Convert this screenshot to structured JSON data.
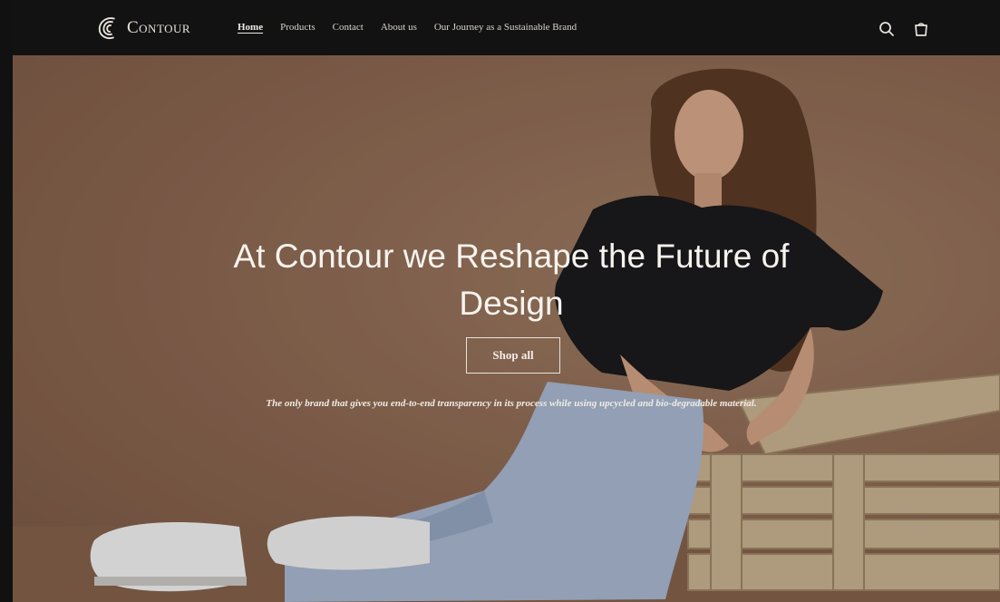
{
  "header": {
    "brand": "Contour",
    "nav": [
      {
        "label": "Home",
        "active": true
      },
      {
        "label": "Products",
        "active": false
      },
      {
        "label": "Contact",
        "active": false
      },
      {
        "label": "About us",
        "active": false
      },
      {
        "label": "Our Journey as a Sustainable Brand",
        "active": false
      }
    ],
    "icons": [
      "search-icon",
      "cart-icon"
    ]
  },
  "hero": {
    "title": "At Contour we Reshape the Future of Design",
    "button_label": "Shop all",
    "subtitle": "The only brand that gives you end-to-end transparency in its process while using upcycled and bio-degradable material."
  },
  "colors": {
    "header_bg": "#121212",
    "hero_bg": "#8f6c55",
    "text_light": "#f7f3ee"
  }
}
